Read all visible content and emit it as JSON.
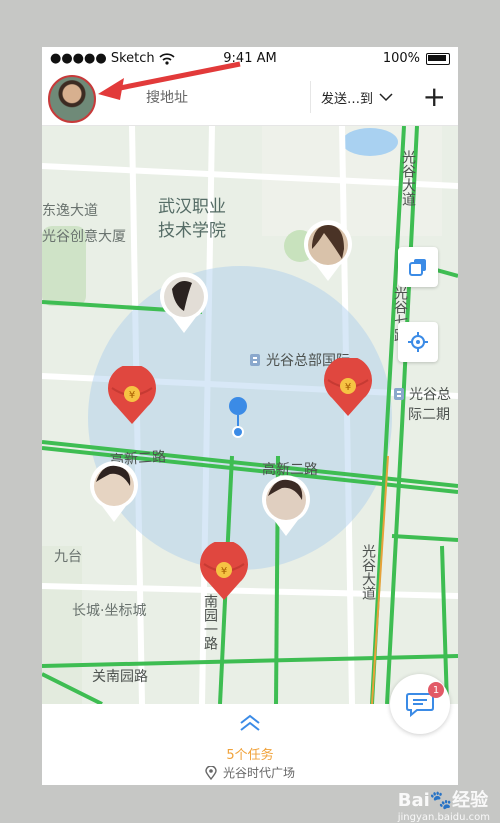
{
  "status_bar": {
    "carrier": "●●●●● Sketch",
    "time": "9:41 AM",
    "battery": "100%"
  },
  "header": {
    "search_placeholder": "搜地址",
    "send_to": "发送…到",
    "add_icon": "plus-icon"
  },
  "map_labels": {
    "wuhan_vocational": [
      "武汉职业",
      "技术学院"
    ],
    "dongyi_avenue": "东逸大道",
    "guanggu_creative": "光谷创意大厦",
    "guanggu_hq": "光谷总部国际",
    "guanggu_hq_2": [
      "光谷总",
      "际二期"
    ],
    "gaoxin_road_left": "高新二路",
    "gaoxin_road_right": "高新二路",
    "jiutai": "九台",
    "changcheng": "长城·坐标城",
    "guannan_road": "关南园路",
    "nanyuan_road": "南园一路",
    "guanggu_avenue_top": "光谷大道",
    "guanggu_avenue_bottom": "光谷大道",
    "guanggu_7road": "光谷七路"
  },
  "bottom": {
    "tasks": "5个任务",
    "location": "光谷时代广场"
  },
  "fab": {
    "badge": "1"
  },
  "watermark": {
    "brand": "Bai🐾经验",
    "domain": "jingyan.baidu.com"
  },
  "colors": {
    "road_green": "#3ebd52",
    "marker_red": "#e0473f",
    "pin_blue": "#3b8be6",
    "tasks_orange": "#f0a23a",
    "badge_red": "#e25a67"
  }
}
